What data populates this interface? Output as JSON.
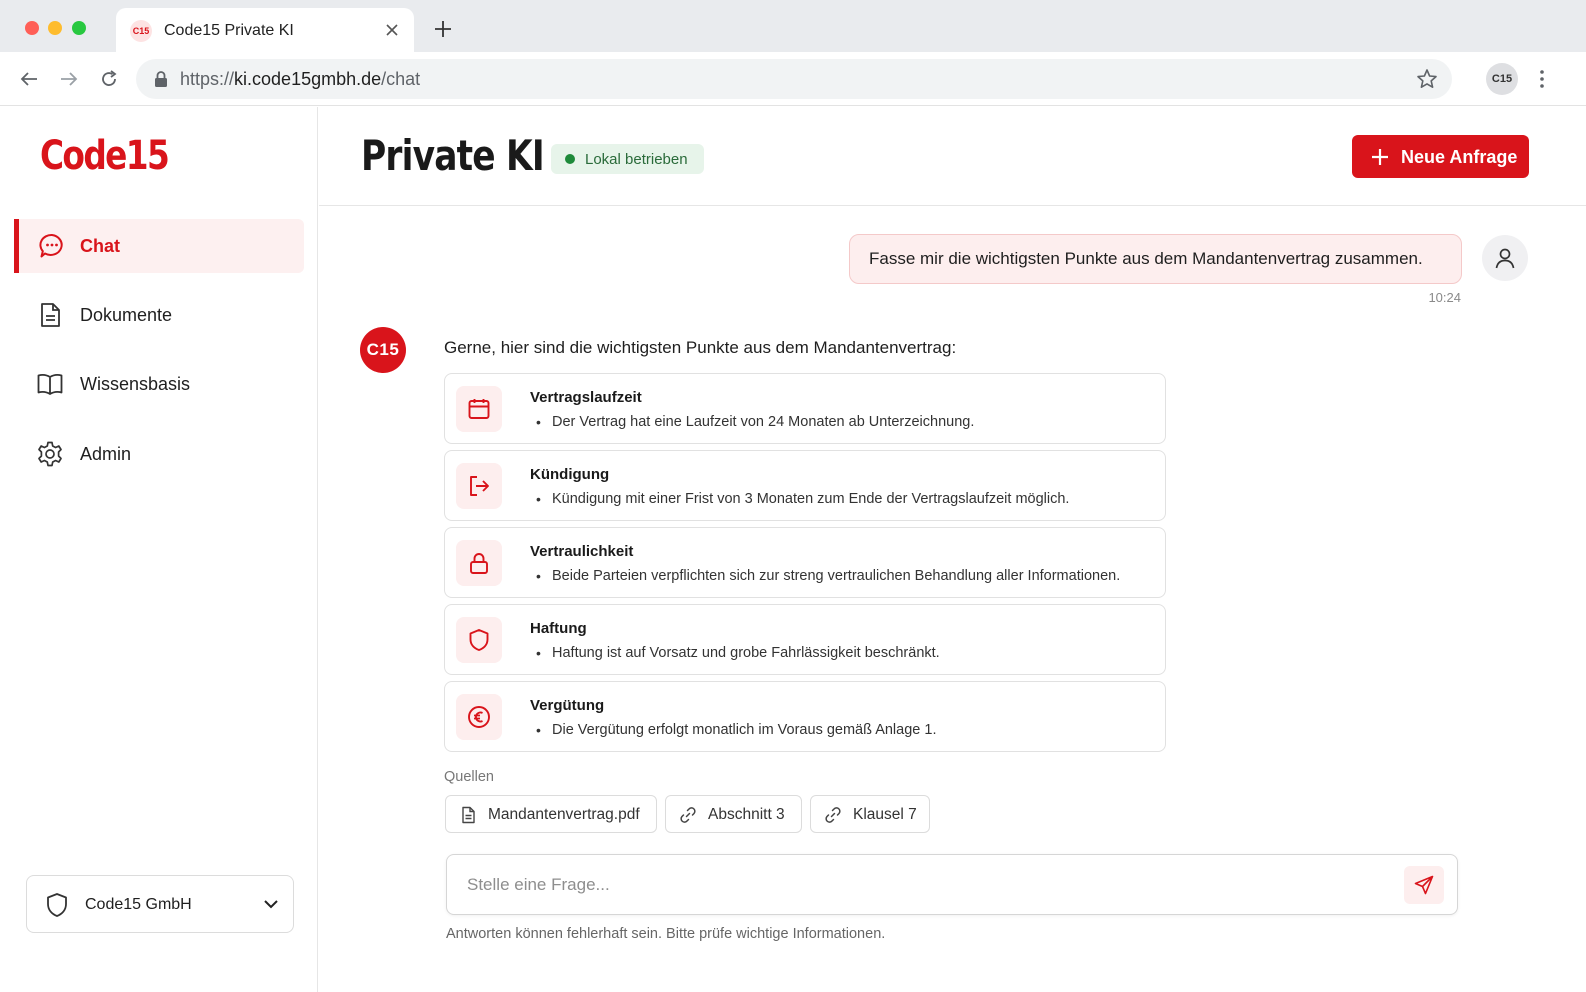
{
  "browser": {
    "tab_favicon": "C15",
    "tab_title": "Code15 Private KI",
    "url_scheme": "https://",
    "url_host": "ki.code15gmbh.de",
    "url_path": "/chat",
    "profile_initials": "C15"
  },
  "sidebar": {
    "logo": "Code15",
    "items": [
      {
        "label": "Chat",
        "icon": "chat-bubble-icon",
        "active": true
      },
      {
        "label": "Dokumente",
        "icon": "document-icon",
        "active": false
      },
      {
        "label": "Wissensbasis",
        "icon": "book-icon",
        "active": false
      },
      {
        "label": "Admin",
        "icon": "gear-icon",
        "active": false
      }
    ],
    "org_name": "Code15 GmbH"
  },
  "header": {
    "title": "Private KI",
    "status": "Lokal betrieben",
    "new_request_label": "Neue Anfrage"
  },
  "chat": {
    "user_message": "Fasse mir die wichtigsten Punkte aus dem Mandantenvertrag zusammen.",
    "user_time": "10:24",
    "bot_avatar": "C15",
    "bot_intro": "Gerne, hier sind die wichtigsten Punkte aus dem Mandantenvertrag:",
    "points": [
      {
        "title": "Vertragslaufzeit",
        "detail": "Der Vertrag hat eine Laufzeit von 24 Monaten ab Unterzeichnung.",
        "icon": "calendar-icon"
      },
      {
        "title": "Kündigung",
        "detail": "Kündigung mit einer Frist von 3 Monaten zum Ende der Vertragslaufzeit möglich.",
        "icon": "exit-icon"
      },
      {
        "title": "Vertraulichkeit",
        "detail": "Beide Parteien verpflichten sich zur streng vertraulichen Behandlung aller Informationen.",
        "icon": "lock-icon"
      },
      {
        "title": "Haftung",
        "detail": "Haftung ist auf Vorsatz und grobe Fahrlässigkeit beschränkt.",
        "icon": "shield-icon"
      },
      {
        "title": "Vergütung",
        "detail": "Die Vergütung erfolgt monatlich im Voraus gemäß Anlage 1.",
        "icon": "euro-icon"
      }
    ],
    "sources_label": "Quellen",
    "sources": [
      {
        "label": "Mandantenvertrag.pdf",
        "icon": "file-icon"
      },
      {
        "label": "Abschnitt 3",
        "icon": "link-icon"
      },
      {
        "label": "Klausel 7",
        "icon": "link-icon"
      }
    ],
    "input_placeholder": "Stelle eine Frage...",
    "disclaimer": "Antworten können fehlerhaft sein. Bitte prüfe wichtige Informationen."
  },
  "colors": {
    "brand": "#d9141b",
    "brand_tint": "#fdeeee",
    "status_green": "#1e8a3a"
  }
}
